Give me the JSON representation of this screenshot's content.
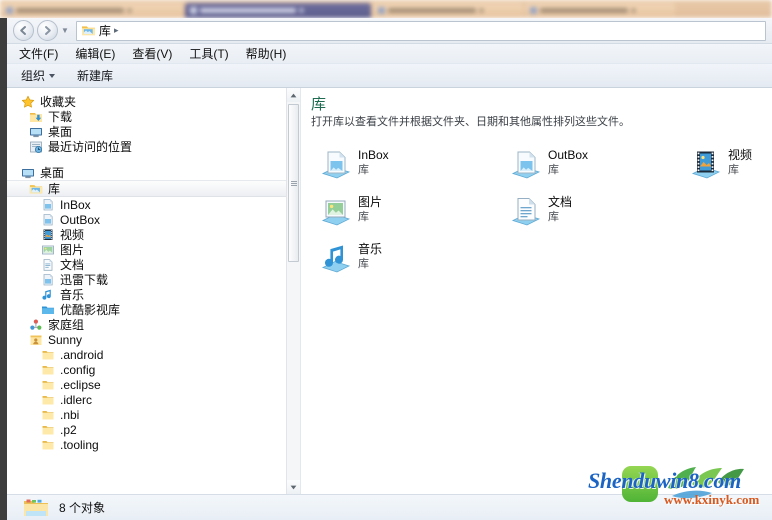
{
  "browser_tabs": [
    {
      "title": "",
      "active": false
    },
    {
      "title": "",
      "active": true
    },
    {
      "title": "",
      "active": false
    },
    {
      "title": "",
      "active": false
    }
  ],
  "address_bar": {
    "back_label": "后退",
    "forward_label": "前进",
    "history_label": "最近的页面",
    "breadcrumb": [
      "库"
    ],
    "separator": "▸"
  },
  "menubar": {
    "items": [
      {
        "label": "文件(F)"
      },
      {
        "label": "编辑(E)"
      },
      {
        "label": "查看(V)"
      },
      {
        "label": "工具(T)"
      },
      {
        "label": "帮助(H)"
      }
    ]
  },
  "toolbar": {
    "organize_label": "组织",
    "new_library_label": "新建库"
  },
  "sidebar": {
    "groups": [
      {
        "header": {
          "label": "收藏夹",
          "icon": "star-icon"
        },
        "items": [
          {
            "label": "下载",
            "icon": "downloads-icon"
          },
          {
            "label": "桌面",
            "icon": "desktop-icon"
          },
          {
            "label": "最近访问的位置",
            "icon": "recent-places-icon"
          }
        ]
      },
      {
        "header": {
          "label": "桌面",
          "icon": "desktop-icon"
        },
        "items": [
          {
            "label": "库",
            "icon": "library-folder-icon",
            "selected": true,
            "level": 1
          },
          {
            "label": "InBox",
            "icon": "library-icon",
            "level": 2
          },
          {
            "label": "OutBox",
            "icon": "library-icon",
            "level": 2
          },
          {
            "label": "视频",
            "icon": "video-library-icon",
            "level": 2
          },
          {
            "label": "图片",
            "icon": "pictures-library-icon",
            "level": 2
          },
          {
            "label": "文档",
            "icon": "documents-library-icon",
            "level": 2
          },
          {
            "label": "迅雷下载",
            "icon": "library-icon",
            "level": 2
          },
          {
            "label": "音乐",
            "icon": "music-library-icon",
            "level": 2
          },
          {
            "label": "优酷影视库",
            "icon": "folder-icon",
            "level": 2
          },
          {
            "label": "家庭组",
            "icon": "homegroup-icon",
            "level": 1
          },
          {
            "label": "Sunny",
            "icon": "user-folder-icon",
            "level": 1
          },
          {
            "label": ".android",
            "icon": "folder-icon",
            "level": 2
          },
          {
            "label": ".config",
            "icon": "folder-icon",
            "level": 2
          },
          {
            "label": ".eclipse",
            "icon": "folder-icon",
            "level": 2
          },
          {
            "label": ".idlerc",
            "icon": "folder-icon",
            "level": 2
          },
          {
            "label": ".nbi",
            "icon": "folder-icon",
            "level": 2
          },
          {
            "label": ".p2",
            "icon": "folder-icon",
            "level": 2
          },
          {
            "label": ".tooling",
            "icon": "folder-icon",
            "level": 2
          }
        ]
      }
    ]
  },
  "content": {
    "title": "库",
    "subtitle": "打开库以查看文件并根据文件夹、日期和其他属性排列这些文件。",
    "items": [
      {
        "name": "InBox",
        "sub": "库",
        "icon": "library-icon",
        "col": 0,
        "row": 0
      },
      {
        "name": "OutBox",
        "sub": "库",
        "icon": "library-icon",
        "col": 1,
        "row": 0
      },
      {
        "name": "视频",
        "sub": "库",
        "icon": "video-library-icon",
        "col": 2,
        "row": 0
      },
      {
        "name": "图片",
        "sub": "库",
        "icon": "pictures-library-icon",
        "col": 0,
        "row": 1
      },
      {
        "name": "文档",
        "sub": "库",
        "icon": "documents-library-icon",
        "col": 1,
        "row": 1
      },
      {
        "name": "音乐",
        "sub": "库",
        "icon": "music-library-icon",
        "col": 0,
        "row": 2
      }
    ]
  },
  "statusbar": {
    "icon": "library-collection-icon",
    "text": "8 个对象"
  },
  "watermarks": {
    "primary": "Shenduwin8.com",
    "secondary": "www.kxinyk.com"
  },
  "colors": {
    "title_green": "#1e6b52",
    "watermark_blue": "#1b64c4",
    "watermark_orange": "#d8591f",
    "active_tab": "#5d5d8c",
    "tabstrip": "#e5c4a2"
  }
}
